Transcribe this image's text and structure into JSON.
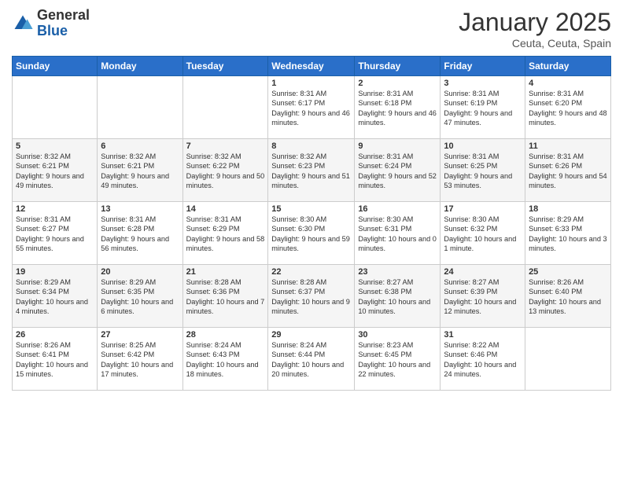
{
  "header": {
    "logo_general": "General",
    "logo_blue": "Blue",
    "month_title": "January 2025",
    "location": "Ceuta, Ceuta, Spain"
  },
  "weekdays": [
    "Sunday",
    "Monday",
    "Tuesday",
    "Wednesday",
    "Thursday",
    "Friday",
    "Saturday"
  ],
  "weeks": [
    [
      {
        "day": "",
        "info": ""
      },
      {
        "day": "",
        "info": ""
      },
      {
        "day": "",
        "info": ""
      },
      {
        "day": "1",
        "info": "Sunrise: 8:31 AM\nSunset: 6:17 PM\nDaylight: 9 hours and 46 minutes."
      },
      {
        "day": "2",
        "info": "Sunrise: 8:31 AM\nSunset: 6:18 PM\nDaylight: 9 hours and 46 minutes."
      },
      {
        "day": "3",
        "info": "Sunrise: 8:31 AM\nSunset: 6:19 PM\nDaylight: 9 hours and 47 minutes."
      },
      {
        "day": "4",
        "info": "Sunrise: 8:31 AM\nSunset: 6:20 PM\nDaylight: 9 hours and 48 minutes."
      }
    ],
    [
      {
        "day": "5",
        "info": "Sunrise: 8:32 AM\nSunset: 6:21 PM\nDaylight: 9 hours and 49 minutes."
      },
      {
        "day": "6",
        "info": "Sunrise: 8:32 AM\nSunset: 6:21 PM\nDaylight: 9 hours and 49 minutes."
      },
      {
        "day": "7",
        "info": "Sunrise: 8:32 AM\nSunset: 6:22 PM\nDaylight: 9 hours and 50 minutes."
      },
      {
        "day": "8",
        "info": "Sunrise: 8:32 AM\nSunset: 6:23 PM\nDaylight: 9 hours and 51 minutes."
      },
      {
        "day": "9",
        "info": "Sunrise: 8:31 AM\nSunset: 6:24 PM\nDaylight: 9 hours and 52 minutes."
      },
      {
        "day": "10",
        "info": "Sunrise: 8:31 AM\nSunset: 6:25 PM\nDaylight: 9 hours and 53 minutes."
      },
      {
        "day": "11",
        "info": "Sunrise: 8:31 AM\nSunset: 6:26 PM\nDaylight: 9 hours and 54 minutes."
      }
    ],
    [
      {
        "day": "12",
        "info": "Sunrise: 8:31 AM\nSunset: 6:27 PM\nDaylight: 9 hours and 55 minutes."
      },
      {
        "day": "13",
        "info": "Sunrise: 8:31 AM\nSunset: 6:28 PM\nDaylight: 9 hours and 56 minutes."
      },
      {
        "day": "14",
        "info": "Sunrise: 8:31 AM\nSunset: 6:29 PM\nDaylight: 9 hours and 58 minutes."
      },
      {
        "day": "15",
        "info": "Sunrise: 8:30 AM\nSunset: 6:30 PM\nDaylight: 9 hours and 59 minutes."
      },
      {
        "day": "16",
        "info": "Sunrise: 8:30 AM\nSunset: 6:31 PM\nDaylight: 10 hours and 0 minutes."
      },
      {
        "day": "17",
        "info": "Sunrise: 8:30 AM\nSunset: 6:32 PM\nDaylight: 10 hours and 1 minute."
      },
      {
        "day": "18",
        "info": "Sunrise: 8:29 AM\nSunset: 6:33 PM\nDaylight: 10 hours and 3 minutes."
      }
    ],
    [
      {
        "day": "19",
        "info": "Sunrise: 8:29 AM\nSunset: 6:34 PM\nDaylight: 10 hours and 4 minutes."
      },
      {
        "day": "20",
        "info": "Sunrise: 8:29 AM\nSunset: 6:35 PM\nDaylight: 10 hours and 6 minutes."
      },
      {
        "day": "21",
        "info": "Sunrise: 8:28 AM\nSunset: 6:36 PM\nDaylight: 10 hours and 7 minutes."
      },
      {
        "day": "22",
        "info": "Sunrise: 8:28 AM\nSunset: 6:37 PM\nDaylight: 10 hours and 9 minutes."
      },
      {
        "day": "23",
        "info": "Sunrise: 8:27 AM\nSunset: 6:38 PM\nDaylight: 10 hours and 10 minutes."
      },
      {
        "day": "24",
        "info": "Sunrise: 8:27 AM\nSunset: 6:39 PM\nDaylight: 10 hours and 12 minutes."
      },
      {
        "day": "25",
        "info": "Sunrise: 8:26 AM\nSunset: 6:40 PM\nDaylight: 10 hours and 13 minutes."
      }
    ],
    [
      {
        "day": "26",
        "info": "Sunrise: 8:26 AM\nSunset: 6:41 PM\nDaylight: 10 hours and 15 minutes."
      },
      {
        "day": "27",
        "info": "Sunrise: 8:25 AM\nSunset: 6:42 PM\nDaylight: 10 hours and 17 minutes."
      },
      {
        "day": "28",
        "info": "Sunrise: 8:24 AM\nSunset: 6:43 PM\nDaylight: 10 hours and 18 minutes."
      },
      {
        "day": "29",
        "info": "Sunrise: 8:24 AM\nSunset: 6:44 PM\nDaylight: 10 hours and 20 minutes."
      },
      {
        "day": "30",
        "info": "Sunrise: 8:23 AM\nSunset: 6:45 PM\nDaylight: 10 hours and 22 minutes."
      },
      {
        "day": "31",
        "info": "Sunrise: 8:22 AM\nSunset: 6:46 PM\nDaylight: 10 hours and 24 minutes."
      },
      {
        "day": "",
        "info": ""
      }
    ]
  ]
}
